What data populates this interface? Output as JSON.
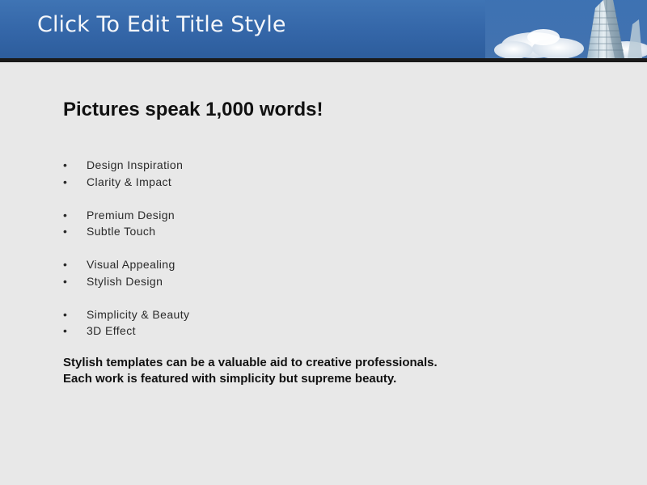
{
  "slide": {
    "title": "Click To Edit Title Style",
    "heading": "Pictures speak 1,000 words!",
    "bullet_groups": [
      [
        "Design Inspiration",
        "Clarity & Impact"
      ],
      [
        "Premium Design",
        "Subtle Touch"
      ],
      [
        "Visual Appealing",
        "Stylish Design"
      ],
      [
        "Simplicity & Beauty",
        "3D Effect"
      ]
    ],
    "summary_lines": [
      "Stylish templates can be a valuable aid to creative professionals.",
      "Each work is featured with simplicity but supreme beauty."
    ]
  },
  "colors": {
    "title_bar": "#3466a8",
    "background": "#e8e8e8",
    "title_text": "#f4f6fa",
    "body_text": "#111111"
  },
  "icons": {
    "header_art": "skyscraper-and-clouds-image"
  }
}
